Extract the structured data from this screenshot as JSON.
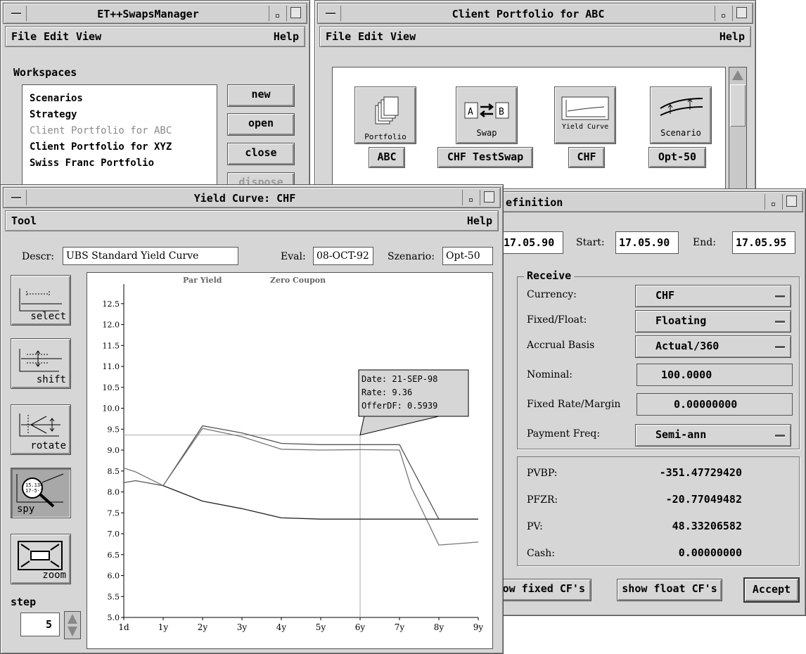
{
  "swaps_manager": {
    "title": "ET++SwapsManager",
    "menu": {
      "file": "File",
      "edit": "Edit",
      "view": "View",
      "help": "Help"
    },
    "workspaces_label": "Workspaces",
    "workspaces": [
      {
        "label": "Scenarios",
        "dimmed": false
      },
      {
        "label": "Strategy",
        "dimmed": false
      },
      {
        "label": "Client Portfolio for ABC",
        "dimmed": true
      },
      {
        "label": "Client Portfolio for XYZ",
        "dimmed": false
      },
      {
        "label": "Swiss Franc Portfolio",
        "dimmed": false
      }
    ],
    "buttons": {
      "new": "new",
      "open": "open",
      "close": "close",
      "dispose": "dispose"
    }
  },
  "portfolio": {
    "title": "Client Portfolio for ABC",
    "menu": {
      "file": "File",
      "edit": "Edit",
      "view": "View",
      "help": "Help"
    },
    "items": [
      {
        "icon_label": "Portfolio",
        "name": "ABC",
        "icon": "portfolio-icon"
      },
      {
        "icon_label": "Swap",
        "name": "CHF TestSwap",
        "icon": "swap-icon"
      },
      {
        "icon_label": "Yield Curve",
        "name": "CHF",
        "icon": "yield-curve-icon"
      },
      {
        "icon_label": "Scenario",
        "name": "Opt-50",
        "icon": "scenario-icon"
      }
    ]
  },
  "definition": {
    "title": "efinition",
    "trade_date": "17.05.90",
    "start_label": "Start:",
    "start": "17.05.90",
    "end_label": "End:",
    "end": "17.05.95",
    "receive_label": "Receive",
    "rows": {
      "currency_label": "Currency:",
      "currency": "CHF",
      "fixed_float_label": "Fixed/Float:",
      "fixed_float": "Floating",
      "accrual_label": "Accrual Basis",
      "accrual": "Actual/360",
      "nominal_label": "Nominal:",
      "nominal": "100.0000",
      "rate_label": "Fixed Rate/Margin",
      "rate": "0.00000000",
      "freq_label": "Payment Freq:",
      "freq": "Semi-ann"
    },
    "results": {
      "pvbp_label": "PVBP:",
      "pvbp": "-351.47729420",
      "pfzr_label": "PFZR:",
      "pfzr": "-20.77049482",
      "pv_label": "PV:",
      "pv": "48.33206582",
      "cash_label": "Cash:",
      "cash": "0.00000000"
    },
    "buttons": {
      "fixed_cf": "ow fixed CF's",
      "float_cf": "show float CF's",
      "accept": "Accept"
    }
  },
  "yield_curve": {
    "title": "Yield Curve:  CHF",
    "menu": {
      "tool": "Tool",
      "help": "Help"
    },
    "descr_label": "Descr:",
    "descr": "UBS Standard Yield Curve",
    "eval_label": "Eval:",
    "eval": "08-OCT-92",
    "scenario_label": "Szenario:",
    "scenario": "Opt-50",
    "tools": [
      {
        "label": "select",
        "icon": "select-icon"
      },
      {
        "label": "shift",
        "icon": "shift-icon"
      },
      {
        "label": "rotate",
        "icon": "rotate-icon"
      },
      {
        "label": "spy",
        "icon": "spy-icon"
      },
      {
        "label": "zoom",
        "icon": "zoom-icon"
      }
    ],
    "spy_badge": "15.134\n17-5-7",
    "step_label": "step",
    "step_value": "5",
    "tooltip": {
      "date": "Date: 21-SEP-98",
      "rate": "Rate:  9.36",
      "offer": "OfferDF: 0.5939"
    }
  },
  "chart_data": {
    "type": "line",
    "title": "",
    "xlabel": "",
    "ylabel": "",
    "categories": [
      "1d",
      "1y",
      "2y",
      "3y",
      "4y",
      "5y",
      "6y",
      "7y",
      "8y",
      "9y"
    ],
    "ylim": [
      5.0,
      12.9
    ],
    "yticks": [
      "12.5",
      "12.0",
      "11.5",
      "11.0",
      "10.5",
      "10.0",
      "9.5",
      "9.0",
      "8.5",
      "8.0",
      "7.5",
      "7.0",
      "6.5",
      "6.0",
      "5.5",
      "5.0"
    ],
    "legend": [
      "Par Yield",
      "Zero Coupon"
    ],
    "series": [
      {
        "name": "Par Yield",
        "x": [
          0,
          0.3,
          1,
          2,
          3,
          4,
          5,
          6,
          7,
          8
        ],
        "values": [
          8.22,
          8.27,
          8.15,
          9.58,
          9.41,
          9.16,
          9.13,
          9.13,
          9.13,
          7.35
        ],
        "color": "#555555"
      },
      {
        "name": "Zero Coupon",
        "x": [
          0,
          0.3,
          1,
          2,
          3,
          4,
          5,
          6,
          7,
          7.3,
          8,
          9
        ],
        "values": [
          8.57,
          8.48,
          8.15,
          9.52,
          9.32,
          9.02,
          9.0,
          9.01,
          9.0,
          8.1,
          6.73,
          6.8
        ],
        "color": "#777777"
      },
      {
        "name": "",
        "x": [
          1,
          2,
          3,
          4,
          5,
          6,
          7,
          8,
          9
        ],
        "values": [
          8.15,
          7.78,
          7.6,
          7.38,
          7.35,
          7.35,
          7.35,
          7.35,
          7.35
        ],
        "color": "#222222"
      }
    ],
    "crosshair": {
      "x": 6,
      "y": 9.36
    }
  }
}
